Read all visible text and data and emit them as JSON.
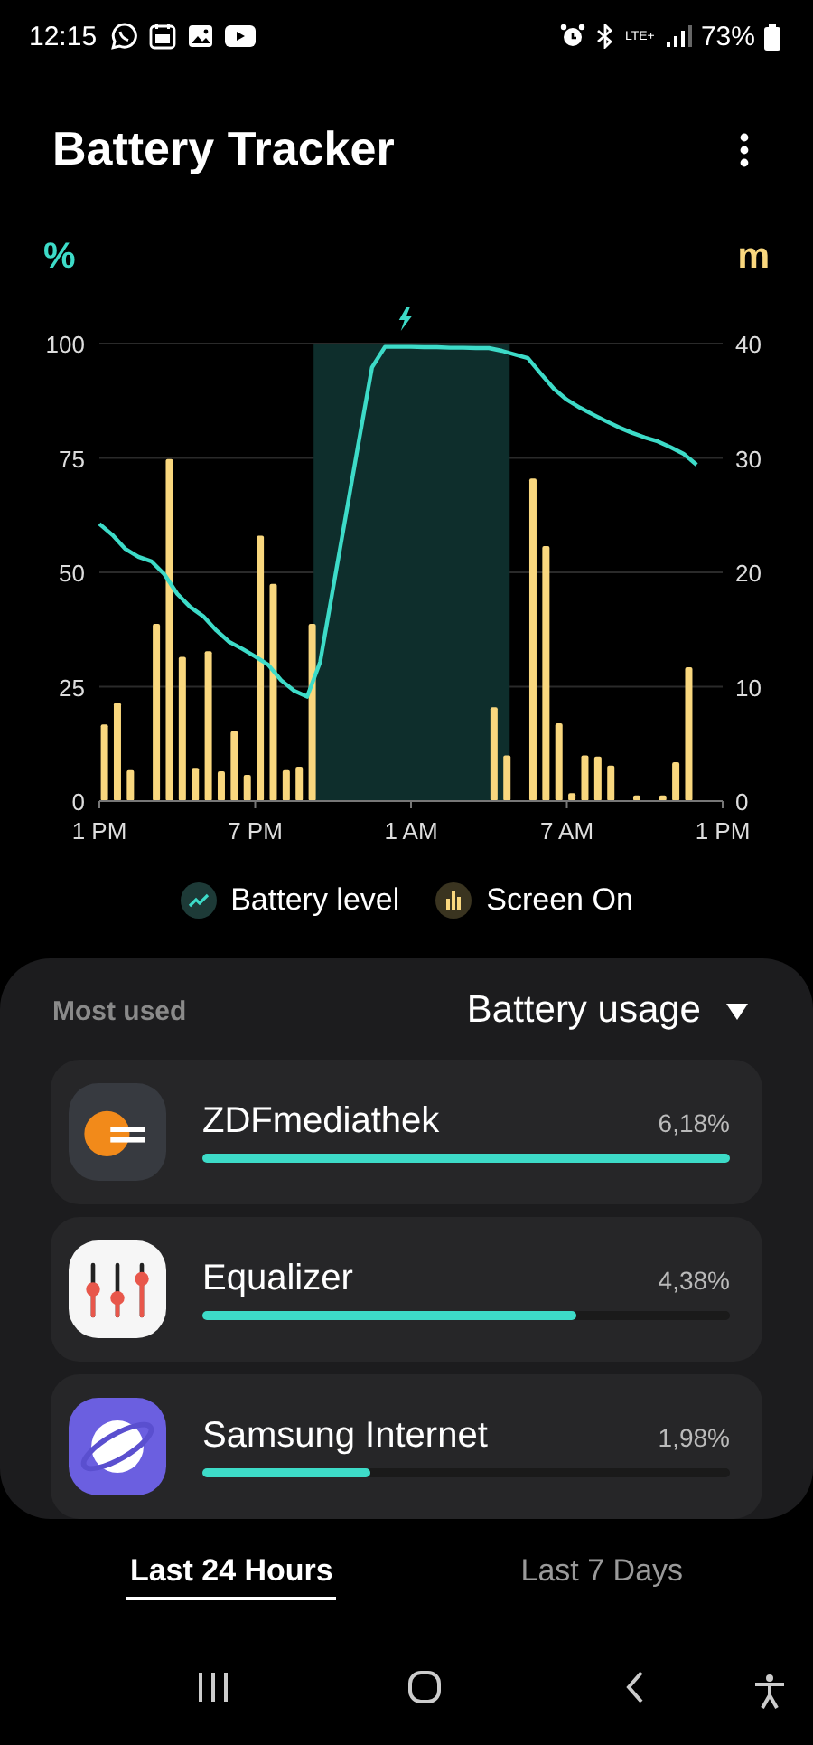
{
  "status_bar": {
    "time": "12:15",
    "network": "LTE+",
    "battery": "73%"
  },
  "header": {
    "title": "Battery Tracker"
  },
  "chart": {
    "chart_data": {
      "type": "bar",
      "ylabel": "%",
      "y2label": "m",
      "ylim": [
        0,
        100
      ],
      "y2lim": [
        0,
        40
      ],
      "categories": [
        "1 PM",
        null,
        null,
        null,
        null,
        null,
        null,
        null,
        null,
        null,
        null,
        null,
        "7 PM",
        null,
        null,
        null,
        null,
        null,
        null,
        null,
        null,
        null,
        null,
        null,
        "1 AM",
        null,
        null,
        null,
        null,
        null,
        null,
        null,
        null,
        null,
        null,
        null,
        "7 AM",
        null,
        null,
        null,
        null,
        null,
        null,
        null,
        null,
        null,
        null,
        null,
        "1 PM"
      ],
      "yticks": [
        0,
        25,
        50,
        75,
        100
      ],
      "y2ticks": [
        0,
        10,
        20,
        30,
        40
      ],
      "series": [
        {
          "name": "Screen On",
          "axis": "y2",
          "color": "#f9d77e",
          "values": [
            6.7,
            8.6,
            2.7,
            null,
            15.5,
            29.9,
            12.6,
            2.9,
            13.1,
            2.6,
            6.1,
            2.3,
            23.2,
            19.0,
            2.7,
            3.0,
            15.5,
            null,
            null,
            null,
            null,
            null,
            null,
            null,
            null,
            null,
            null,
            null,
            null,
            null,
            8.2,
            4.0,
            null,
            28.2,
            22.3,
            6.8,
            0.7,
            4.0,
            3.9,
            3.1,
            null,
            0.5,
            null,
            0.5,
            3.4,
            11.7,
            null,
            null,
            null
          ]
        },
        {
          "name": "Battery level",
          "type": "line",
          "color": "#3ddbc8",
          "values": [
            60.6,
            58.2,
            55.1,
            53.4,
            52.4,
            49.6,
            45.3,
            42.4,
            40.4,
            37.3,
            34.8,
            33.3,
            31.6,
            29.8,
            26.4,
            24.1,
            22.8,
            30.4,
            46.6,
            62.8,
            79.1,
            94.8,
            99.3,
            99.3,
            99.3,
            99.2,
            99.2,
            99.1,
            99.1,
            99.0,
            99.0,
            98.4,
            97.6,
            96.8,
            93.4,
            90.1,
            87.7,
            86.0,
            84.5,
            83.1,
            81.7,
            80.5,
            79.5,
            78.6,
            77.3,
            75.9,
            73.5,
            null,
            null
          ]
        }
      ],
      "grid": true
    }
  },
  "usage": {
    "heading": "Most used",
    "sort": "Battery usage",
    "apps": [
      {
        "name": "ZDFmediathek",
        "kind": "zdf",
        "percent": "6,18%",
        "level": 1.0
      },
      {
        "name": "Equalizer",
        "kind": "equalizer",
        "percent": "4,38%",
        "level": 0.71
      },
      {
        "name": "Samsung Internet",
        "kind": "browser",
        "percent": "1,98%",
        "level": 0.32
      }
    ]
  },
  "tabs": [
    {
      "label": "Last 24 Hours",
      "selected": true
    },
    {
      "label": "Last 7 Days",
      "selected": false
    }
  ]
}
